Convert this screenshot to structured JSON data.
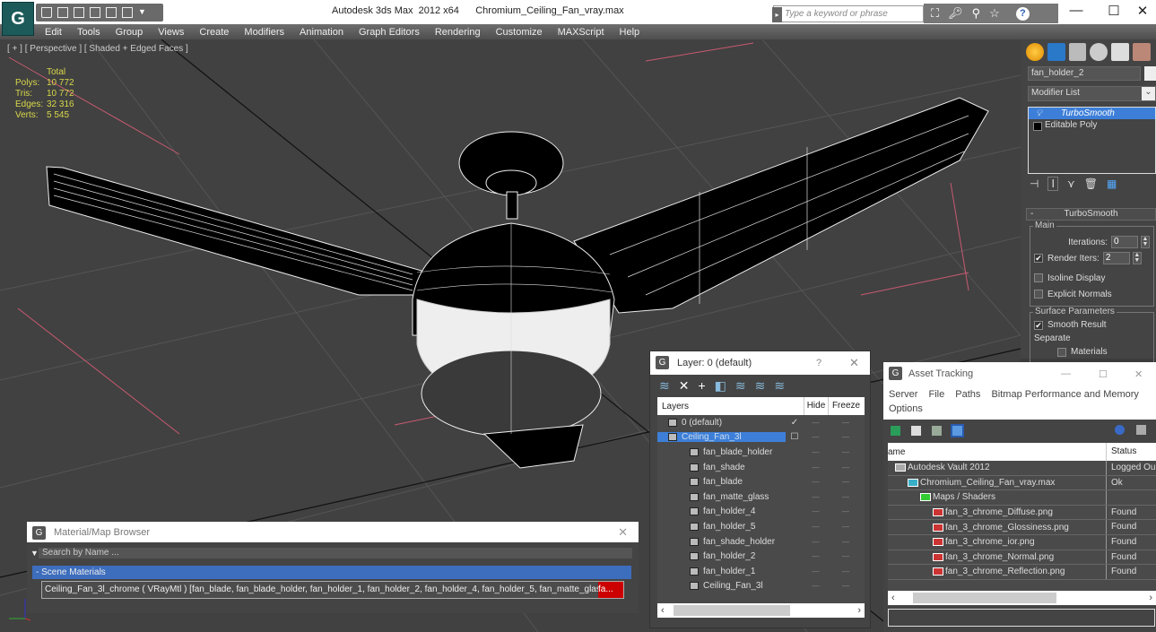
{
  "window": {
    "app_title": "Autodesk 3ds Max  2012 x64",
    "file_title": "Chromium_Ceiling_Fan_vray.max",
    "search_placeholder": "Type a keyword or phrase",
    "minimize": "—",
    "maximize": "☐",
    "close": "✕"
  },
  "menu": [
    "Edit",
    "Tools",
    "Group",
    "Views",
    "Create",
    "Modifiers",
    "Animation",
    "Graph Editors",
    "Rendering",
    "Customize",
    "MAXScript",
    "Help"
  ],
  "viewport": {
    "label": "[ + ] [ Perspective ] [ Shaded + Edged Faces ]",
    "stats": {
      "header": "Total",
      "rows": [
        {
          "label": "Polys:",
          "value": "10 772"
        },
        {
          "label": "Tris:",
          "value": "10 772"
        },
        {
          "label": "Edges:",
          "value": "32 316"
        },
        {
          "label": "Verts:",
          "value": "5 545"
        }
      ]
    }
  },
  "command_panel": {
    "object_name": "fan_holder_2",
    "modifier_list": "Modifier List",
    "stack": [
      {
        "label": "TurboSmooth",
        "selected": true
      },
      {
        "label": "Editable Poly",
        "selected": false
      }
    ],
    "rollout": {
      "title": "TurboSmooth",
      "main_group": "Main",
      "iterations_label": "Iterations:",
      "iterations_value": "0",
      "render_iters_label": "Render Iters:",
      "render_iters_value": "2",
      "render_iters_checked": true,
      "isoline_label": "Isoline Display",
      "explicit_normals_label": "Explicit Normals",
      "surface_group": "Surface Parameters",
      "smooth_result_label": "Smooth Result",
      "separate_label": "Separate",
      "materials_label": "Materials"
    }
  },
  "layer_dialog": {
    "title": "Layer: 0 (default)",
    "help": "?",
    "close": "✕",
    "columns": [
      "Layers",
      "",
      "Hide",
      "Freeze"
    ],
    "rows": [
      {
        "name": "0 (default)",
        "type": "layer",
        "check": "✓",
        "selected": false
      },
      {
        "name": "Ceiling_Fan_3l",
        "type": "layer",
        "check": "☐",
        "selected": true
      },
      {
        "name": "fan_blade_holder",
        "type": "object"
      },
      {
        "name": "fan_shade",
        "type": "object"
      },
      {
        "name": "fan_blade",
        "type": "object"
      },
      {
        "name": "fan_matte_glass",
        "type": "object"
      },
      {
        "name": "fan_holder_4",
        "type": "object"
      },
      {
        "name": "fan_holder_5",
        "type": "object"
      },
      {
        "name": "fan_shade_holder",
        "type": "object"
      },
      {
        "name": "fan_holder_2",
        "type": "object"
      },
      {
        "name": "fan_holder_1",
        "type": "object"
      },
      {
        "name": "Ceiling_Fan_3l",
        "type": "object"
      }
    ],
    "dash": "—"
  },
  "asset_tracking": {
    "title": "Asset Tracking",
    "menu": [
      "Server",
      "File",
      "Paths",
      "Bitmap Performance and Memory",
      "Options"
    ],
    "columns": [
      "ame",
      "Status"
    ],
    "rows": [
      {
        "name": "Autodesk Vault 2012",
        "status": "Logged Ou",
        "indent": 0,
        "icon": "vault"
      },
      {
        "name": "Chromium_Ceiling_Fan_vray.max",
        "status": "Ok",
        "indent": 1,
        "icon": "max"
      },
      {
        "name": "Maps / Shaders",
        "status": "",
        "indent": 2,
        "icon": "maps"
      },
      {
        "name": "fan_3_chrome_Diffuse.png",
        "status": "Found",
        "indent": 3,
        "icon": "png"
      },
      {
        "name": "fan_3_chrome_Glossiness.png",
        "status": "Found",
        "indent": 3,
        "icon": "png"
      },
      {
        "name": "fan_3_chrome_ior.png",
        "status": "Found",
        "indent": 3,
        "icon": "png"
      },
      {
        "name": "fan_3_chrome_Normal.png",
        "status": "Found",
        "indent": 3,
        "icon": "png"
      },
      {
        "name": "fan_3_chrome_Reflection.png",
        "status": "Found",
        "indent": 3,
        "icon": "png"
      }
    ]
  },
  "material_browser": {
    "title": "Material/Map Browser",
    "search_placeholder": "Search by Name ...",
    "section": "- Scene Materials",
    "item": "Ceiling_Fan_3l_chrome ( VRayMtl ) [fan_blade, fan_blade_holder, fan_holder_1, fan_holder_2, fan_holder_4, fan_holder_5, fan_matte_glass,",
    "item_overflow": "fa..."
  }
}
